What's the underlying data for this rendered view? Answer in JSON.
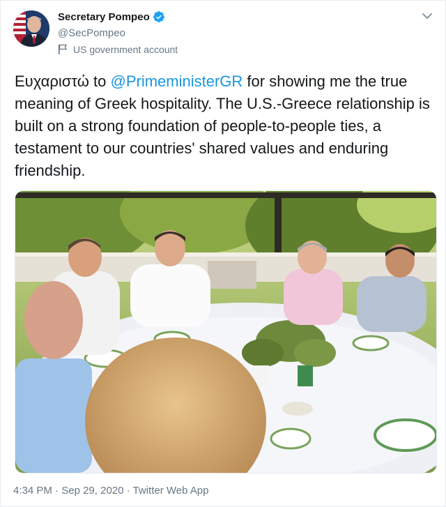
{
  "author": {
    "display_name": "Secretary Pompeo",
    "handle": "@SecPompeo",
    "account_label": "US government account"
  },
  "tweet": {
    "text_before": "Ευχαριστώ to ",
    "mention": "@PrimeministerGR",
    "text_after": " for showing me the true meaning of Greek hospitality. The U.S.-Greece relationship is built on a strong foundation of people-to-people ties, a testament to our countries' shared values and enduring friendship."
  },
  "meta": {
    "time": "4:34 PM",
    "date": "Sep 29, 2020",
    "source": "Twitter Web App",
    "separator": " · "
  },
  "colors": {
    "accent": "#1b95e0",
    "secondary_text": "#657786",
    "primary_text": "#14171a"
  },
  "icons": {
    "verified": "verified-badge-icon",
    "government": "flag-icon",
    "caret": "chevron-down-icon"
  }
}
